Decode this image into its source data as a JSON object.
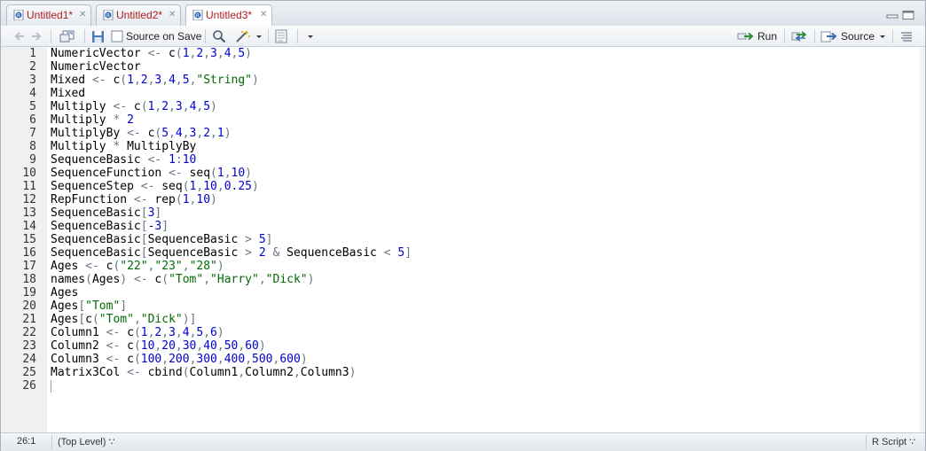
{
  "tabs": [
    {
      "label": "Untitled1*"
    },
    {
      "label": "Untitled2*"
    },
    {
      "label": "Untitled3*",
      "active": true
    }
  ],
  "toolbar": {
    "source_on_save_label": "Source on Save",
    "run_label": "Run",
    "source_label": "Source"
  },
  "editor": {
    "lines": [
      {
        "n": "1",
        "text": "NumericVector <- c(1,2,3,4,5)"
      },
      {
        "n": "2",
        "text": "NumericVector"
      },
      {
        "n": "3",
        "text": "Mixed <- c(1,2,3,4,5,\"String\")"
      },
      {
        "n": "4",
        "text": "Mixed"
      },
      {
        "n": "5",
        "text": "Multiply <- c(1,2,3,4,5)"
      },
      {
        "n": "6",
        "text": "Multiply * 2"
      },
      {
        "n": "7",
        "text": "MultiplyBy <- c(5,4,3,2,1)"
      },
      {
        "n": "8",
        "text": "Multiply * MultiplyBy"
      },
      {
        "n": "9",
        "text": "SequenceBasic <- 1:10"
      },
      {
        "n": "10",
        "text": "SequenceFunction <- seq(1,10)"
      },
      {
        "n": "11",
        "text": "SequenceStep <- seq(1,10,0.25)"
      },
      {
        "n": "12",
        "text": "RepFunction <- rep(1,10)"
      },
      {
        "n": "13",
        "text": "SequenceBasic[3]"
      },
      {
        "n": "14",
        "text": "SequenceBasic[-3]"
      },
      {
        "n": "15",
        "text": "SequenceBasic[SequenceBasic > 5]"
      },
      {
        "n": "16",
        "text": "SequenceBasic[SequenceBasic > 2 & SequenceBasic < 5]"
      },
      {
        "n": "17",
        "text": "Ages <- c(\"22\",\"23\",\"28\")"
      },
      {
        "n": "18",
        "text": "names(Ages) <- c(\"Tom\",\"Harry\",\"Dick\")"
      },
      {
        "n": "19",
        "text": "Ages"
      },
      {
        "n": "20",
        "text": "Ages[\"Tom\"]"
      },
      {
        "n": "21",
        "text": "Ages[c(\"Tom\",\"Dick\")]"
      },
      {
        "n": "22",
        "text": "Column1 <- c(1,2,3,4,5,6)"
      },
      {
        "n": "23",
        "text": "Column2 <- c(10,20,30,40,50,60)"
      },
      {
        "n": "24",
        "text": "Column3 <- c(100,200,300,400,500,600)"
      },
      {
        "n": "25",
        "text": "Matrix3Col <- cbind(Column1,Column2,Column3)"
      },
      {
        "n": "26",
        "text": ""
      }
    ]
  },
  "status": {
    "position": "26:1",
    "scope": "(Top Level) ∵",
    "file_type": "R Script ∵"
  },
  "colors": {
    "number": "#0000cd",
    "string": "#036a07",
    "operator": "#687687",
    "tab_label": "#b01c1c"
  }
}
